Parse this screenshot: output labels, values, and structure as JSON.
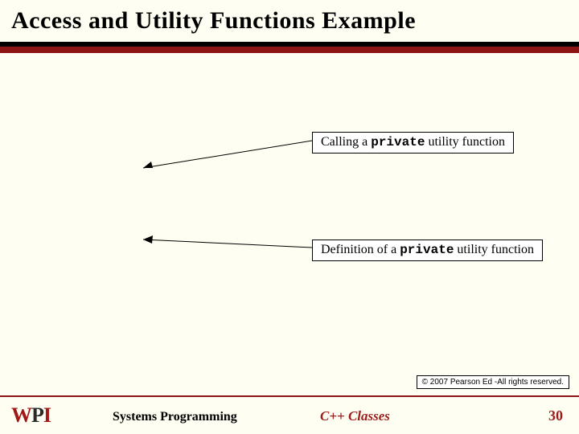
{
  "title": "Access and Utility Functions Example",
  "callouts": {
    "top": {
      "prefix": "Calling a ",
      "keyword": "private",
      "suffix": " utility function"
    },
    "bottom": {
      "prefix": "Definition of a ",
      "keyword": "private",
      "suffix": " utility function"
    }
  },
  "copyright": "© 2007 Pearson Ed -All rights reserved.",
  "footer": {
    "course": "Systems Programming",
    "topic": "C++ Classes",
    "page": "30"
  },
  "logo": {
    "w": "W",
    "p": "P",
    "i": "I"
  }
}
